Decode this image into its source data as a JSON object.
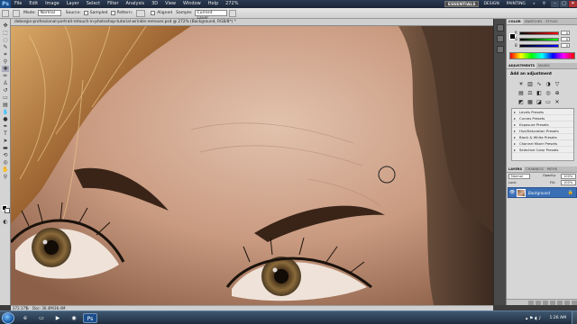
{
  "menu": {
    "logo": "Ps",
    "items": [
      "File",
      "Edit",
      "Image",
      "Layer",
      "Select",
      "Filter",
      "Analysis",
      "3D",
      "View",
      "Window",
      "Help"
    ],
    "zoom": "272%",
    "workspace": {
      "active": "ESSENTIALS",
      "others": [
        "DESIGN",
        "PAINTING"
      ]
    },
    "overflow": "»",
    "search_icon": "search-icon",
    "window_controls": [
      "–",
      "□",
      "✕"
    ]
  },
  "options": {
    "mode_label": "Mode:",
    "mode_value": "Normal",
    "source_label": "Source:",
    "source_sampled": "Sampled",
    "source_pattern": "Pattern:",
    "aligned_label": "Aligned",
    "sample_label": "Sample:",
    "sample_value": "Current Layer"
  },
  "document": {
    "title": "deborgie-professional-portrait-retouch-in-photoshop-tutorial-wrinkle-remover.psd @ 272% (Background, RGB/8*) *"
  },
  "status": {
    "zoom": "272.17%",
    "doc": "Doc: 36.4M/36.4M"
  },
  "panels": {
    "color_tabs": [
      "COLOR",
      "SWATCHES",
      "STYLES"
    ],
    "sliders": [
      {
        "label": "R",
        "value": "0"
      },
      {
        "label": "G",
        "value": "0"
      },
      {
        "label": "B",
        "value": "0"
      }
    ],
    "adjust_tabs": [
      "ADJUSTMENTS",
      "MASKS"
    ],
    "adjust_title": "Add an adjustment",
    "presets": [
      "Levels Presets",
      "Curves Presets",
      "Exposure Presets",
      "Hue/Saturation Presets",
      "Black & White Presets",
      "Channel Mixer Presets",
      "Selective Color Presets"
    ],
    "layers_tabs": [
      "LAYERS",
      "CHANNELS",
      "PATHS"
    ],
    "blend_mode": "Normal",
    "opacity_label": "Opacity:",
    "opacity_value": "100%",
    "lock_label": "Lock:",
    "fill_label": "Fill:",
    "fill_value": "100%",
    "layer_name": "Background"
  },
  "taskbar": {
    "clock": "1:26 AM"
  }
}
